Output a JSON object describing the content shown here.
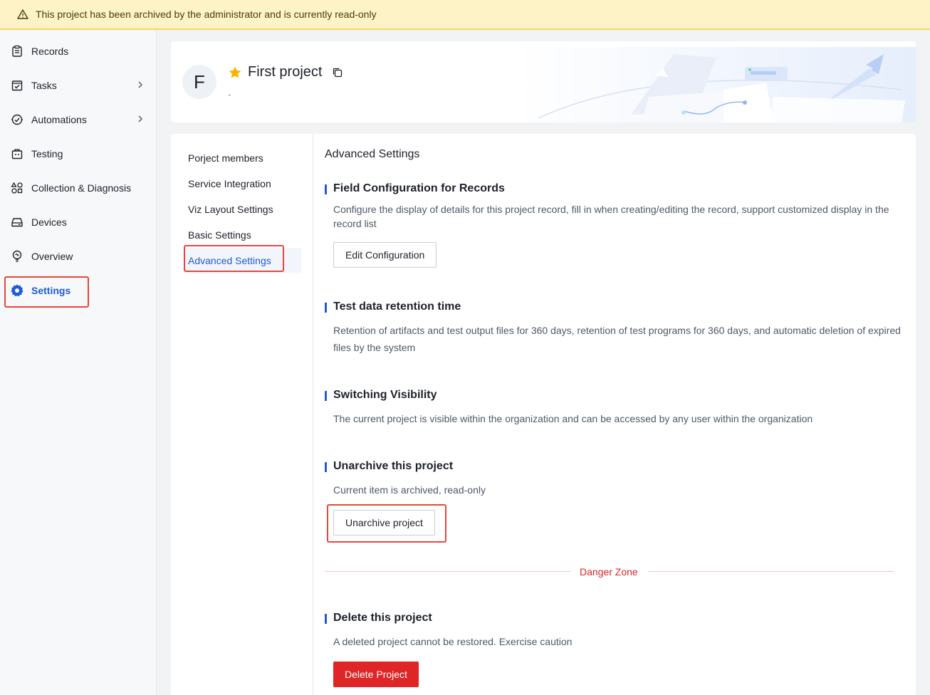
{
  "banner": {
    "text": "This project has been archived by the administrator and is currently read-only",
    "icon": "warning-icon"
  },
  "sidebar": {
    "items": [
      {
        "label": "Records",
        "icon": "records-icon"
      },
      {
        "label": "Tasks",
        "icon": "tasks-icon",
        "has_submenu": true
      },
      {
        "label": "Automations",
        "icon": "automations-icon",
        "has_submenu": true
      },
      {
        "label": "Testing",
        "icon": "testing-icon"
      },
      {
        "label": "Collection & Diagnosis",
        "icon": "collection-icon"
      },
      {
        "label": "Devices",
        "icon": "devices-icon"
      },
      {
        "label": "Overview",
        "icon": "overview-icon"
      },
      {
        "label": "Settings",
        "icon": "settings-gear-icon",
        "active": true
      }
    ]
  },
  "project": {
    "avatar_letter": "F",
    "title": "First project",
    "subtitle": "-",
    "starred": true
  },
  "subnav": {
    "items": [
      {
        "label": "Porject members"
      },
      {
        "label": "Service Integration"
      },
      {
        "label": "Viz Layout Settings"
      },
      {
        "label": "Basic Settings"
      },
      {
        "label": "Advanced Settings",
        "active": true
      }
    ]
  },
  "content": {
    "page_title": "Advanced Settings",
    "field_config": {
      "title": "Field Configuration for Records",
      "desc": "Configure the display of details for this project record, fill in when creating/editing the record, support customized display in the record list",
      "button": "Edit Configuration"
    },
    "retention": {
      "title": "Test data retention time",
      "desc": "Retention of artifacts and test output files for 360 days, retention of test programs for 360 days, and automatic deletion of expired files by the system"
    },
    "visibility": {
      "title": "Switching Visibility",
      "desc": "The current project is visible within the organization and can be accessed by any user within the organization"
    },
    "unarchive": {
      "title": "Unarchive this project",
      "desc": "Current item is archived, read-only",
      "button": "Unarchive project"
    },
    "danger_zone_label": "Danger Zone",
    "delete": {
      "title": "Delete this project",
      "desc": "A deleted project cannot be restored. Exercise caution",
      "button": "Delete Project"
    }
  },
  "colors": {
    "accent": "#1e5bd8",
    "danger": "#df2525",
    "banner_bg": "#fdf3c7",
    "highlight": "#e5483b"
  }
}
